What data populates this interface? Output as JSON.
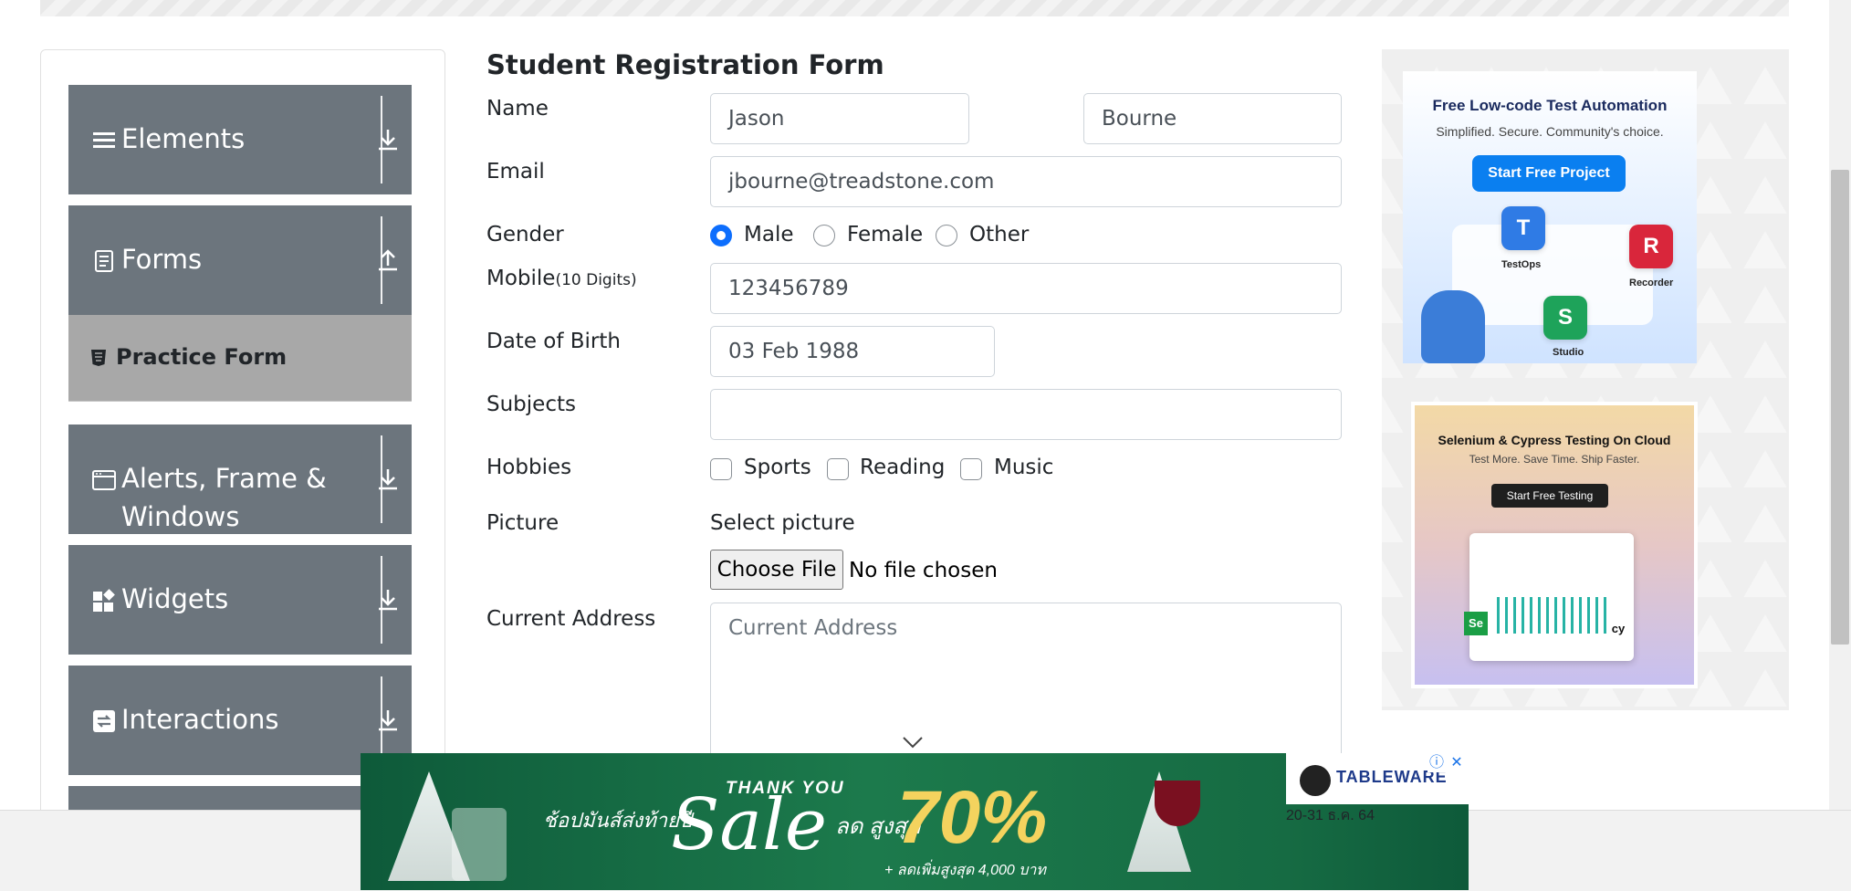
{
  "sidebar": {
    "groups": [
      {
        "label": "Elements",
        "icon": "menu-icon",
        "arrow": "download-icon"
      },
      {
        "label": "Forms",
        "icon": "document-icon",
        "arrow": "upload-icon"
      },
      {
        "label": "Alerts, Frame &",
        "label2": "Windows",
        "icon": "window-icon",
        "arrow": "download-icon"
      },
      {
        "label": "Widgets",
        "icon": "widgets-icon",
        "arrow": "download-icon"
      },
      {
        "label": "Interactions",
        "icon": "interactions-icon",
        "arrow": "download-icon"
      }
    ],
    "active_item": "Practice Form"
  },
  "form": {
    "title": "Student Registration Form",
    "name_label": "Name",
    "first_name": "Jason",
    "last_name": "Bourne",
    "email_label": "Email",
    "email": "jbourne@treadstone.com",
    "gender_label": "Gender",
    "genders": [
      "Male",
      "Female",
      "Other"
    ],
    "gender_selected": "Male",
    "mobile_label": "Mobile",
    "mobile_hint": "(10 Digits)",
    "mobile": "123456789",
    "dob_label": "Date of Birth",
    "dob": "03 Feb 1988",
    "subjects_label": "Subjects",
    "hobbies_label": "Hobbies",
    "hobbies": [
      "Sports",
      "Reading",
      "Music"
    ],
    "picture_label": "Picture",
    "select_picture": "Select picture",
    "choose_file": "Choose File",
    "no_file": "No file chosen",
    "address_label": "Current Address",
    "address_placeholder": "Current Address"
  },
  "ads": {
    "ad1": {
      "title": "Free Low-code Test Automation",
      "subtitle": "Simplified. Secure. Community's choice.",
      "cta": "Start Free Project",
      "tiles": [
        "TestOps",
        "Recorder",
        "Studio"
      ]
    },
    "ad2": {
      "title": "Selenium & Cypress Testing On Cloud",
      "subtitle": "Test More. Save Time. Ship Faster.",
      "cta": "Start Free Testing"
    }
  },
  "bottom_banner": {
    "thai_left": "ช้อปมันส์ส่งท้ายปี",
    "thank_you": "THANK YOU",
    "sale": "Sale",
    "discount_word": "ลด สูงสุด",
    "percent": "70%",
    "extra": "+ ลดเพิ่มสูงสุด 4,000 บาท",
    "brand": "TABLEWARE",
    "dates": "20-31 ธ.ค. 64",
    "colors": {
      "green": "#1c7a4c",
      "gold": "#f4d35e",
      "red": "#c8102e"
    }
  },
  "colors": {
    "sidebar_group": "#6c757d",
    "sidebar_active": "#a8a8a8",
    "radio_selected": "#0d6efd"
  }
}
